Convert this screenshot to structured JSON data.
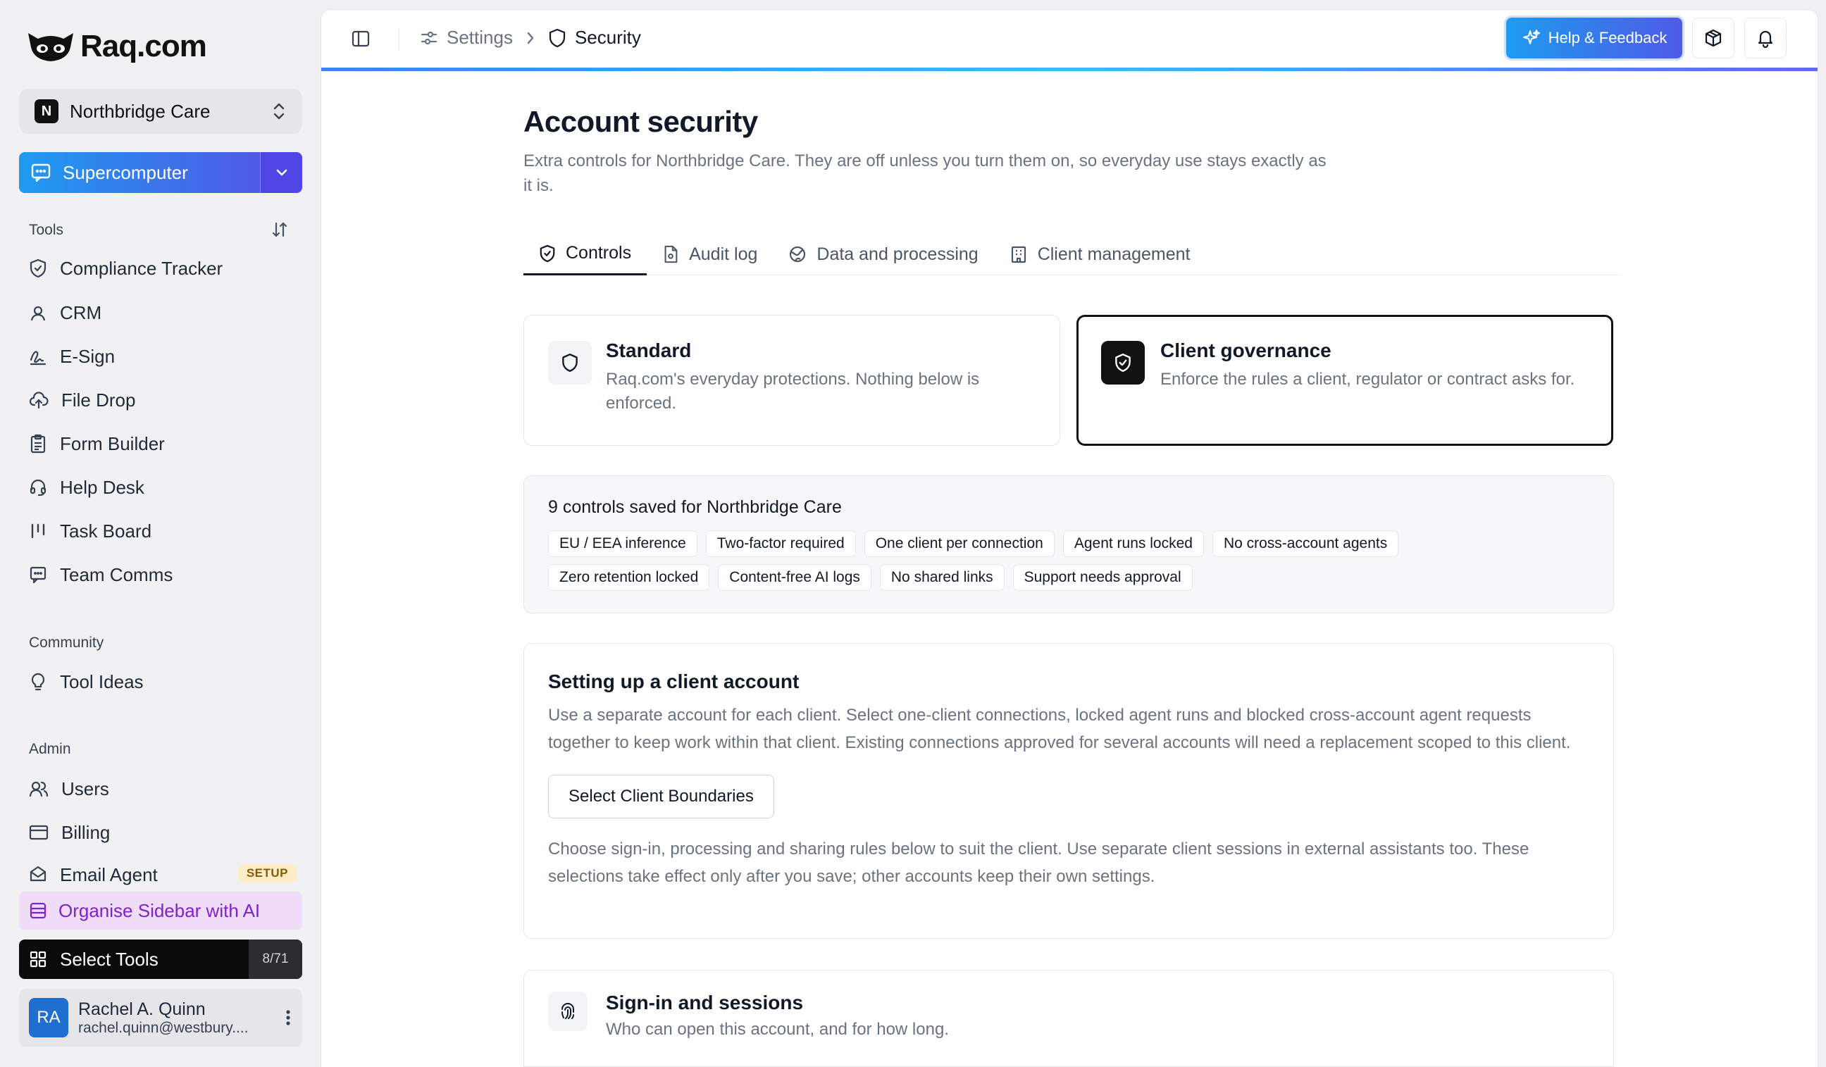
{
  "brand": {
    "name": "Raq.com"
  },
  "org": {
    "badge": "N",
    "name": "Northbridge Care"
  },
  "supercomputer": {
    "label": "Supercomputer"
  },
  "sidebar": {
    "tools_label": "Tools",
    "tools": [
      {
        "label": "Compliance Tracker",
        "icon": "shield-check-icon"
      },
      {
        "label": "CRM",
        "icon": "contact-icon"
      },
      {
        "label": "E-Sign",
        "icon": "signature-icon"
      },
      {
        "label": "File Drop",
        "icon": "cloud-upload-icon"
      },
      {
        "label": "Form Builder",
        "icon": "clipboard-icon"
      },
      {
        "label": "Help Desk",
        "icon": "headset-icon"
      },
      {
        "label": "Task Board",
        "icon": "kanban-icon"
      },
      {
        "label": "Team Comms",
        "icon": "chat-icon"
      }
    ],
    "community_label": "Community",
    "community": [
      {
        "label": "Tool Ideas",
        "icon": "lightbulb-icon"
      }
    ],
    "admin_label": "Admin",
    "admin": [
      {
        "label": "Users",
        "icon": "users-icon"
      },
      {
        "label": "Billing",
        "icon": "credit-card-icon"
      },
      {
        "label": "Email Agent",
        "icon": "mail-open-icon",
        "badge": "SETUP"
      }
    ],
    "organise_label": "Organise Sidebar with AI",
    "select_tools_label": "Select Tools",
    "select_tools_count": "8/71"
  },
  "user": {
    "initials": "RA",
    "name": "Rachel A. Quinn",
    "email": "rachel.quinn@westbury...."
  },
  "header": {
    "breadcrumb_parent": "Settings",
    "breadcrumb_current": "Security",
    "help_label": "Help & Feedback"
  },
  "page": {
    "title": "Account security",
    "subtitle": "Extra controls for Northbridge Care. They are off unless you turn them on, so everyday use stays exactly as it is."
  },
  "tabs": [
    {
      "label": "Controls",
      "active": true
    },
    {
      "label": "Audit log",
      "active": false
    },
    {
      "label": "Data and processing",
      "active": false
    },
    {
      "label": "Client management",
      "active": false
    }
  ],
  "modes": {
    "standard": {
      "title": "Standard",
      "desc": "Raq.com's everyday protections. Nothing below is enforced."
    },
    "governance": {
      "title": "Client governance",
      "desc": "Enforce the rules a client, regulator or contract asks for.",
      "selected": true
    }
  },
  "saved": {
    "title": "9 controls saved for Northbridge Care",
    "chips": [
      "EU / EEA inference",
      "Two-factor required",
      "One client per connection",
      "Agent runs locked",
      "No cross-account agents",
      "Zero retention locked",
      "Content-free AI logs",
      "No shared links",
      "Support needs approval"
    ]
  },
  "setup": {
    "title": "Setting up a client account",
    "text": "Use a separate account for each client. Select one-client connections, locked agent runs and blocked cross-account agent requests together to keep work within that client. Existing connections approved for several accounts will need a replacement scoped to this client.",
    "button": "Select Client Boundaries",
    "note": "Choose sign-in, processing and sharing rules below to suit the client. Use separate client sessions in external assistants too. These selections take effect only after you save; other accounts keep their own settings."
  },
  "signin": {
    "title": "Sign-in and sessions",
    "desc": "Who can open this account, and for how long."
  }
}
